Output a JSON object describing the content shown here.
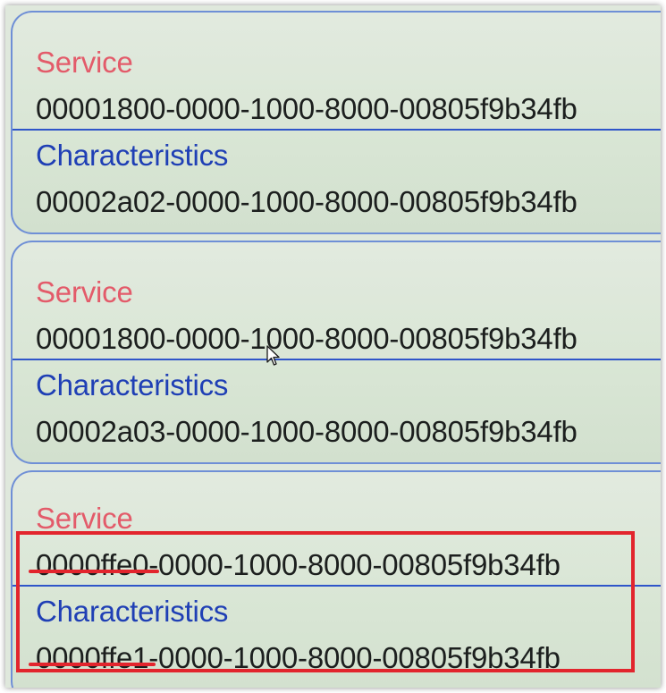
{
  "cards": [
    {
      "service_label": "Service",
      "service_uuid": "00001800-0000-1000-8000-00805f9b34fb",
      "characteristics_label": "Characteristics",
      "characteristics_uuid": "00002a02-0000-1000-8000-00805f9b34fb"
    },
    {
      "service_label": "Service",
      "service_uuid": "00001800-0000-1000-8000-00805f9b34fb",
      "characteristics_label": "Characteristics",
      "characteristics_uuid": "00002a03-0000-1000-8000-00805f9b34fb"
    },
    {
      "service_label": "Service",
      "service_uuid": "0000ffe0-0000-1000-8000-00805f9b34fb",
      "characteristics_label": "Characteristics",
      "characteristics_uuid": "0000ffe1-0000-1000-8000-00805f9b34fb"
    }
  ],
  "annotation": {
    "highlight_color": "#e2252d"
  },
  "colors": {
    "service_label": "#e35b6a",
    "characteristics_label": "#1f3fb5",
    "divider": "#2f55c9",
    "card_border": "#6f8fd6"
  },
  "icons": {
    "cursor": "mouse-pointer-icon"
  }
}
